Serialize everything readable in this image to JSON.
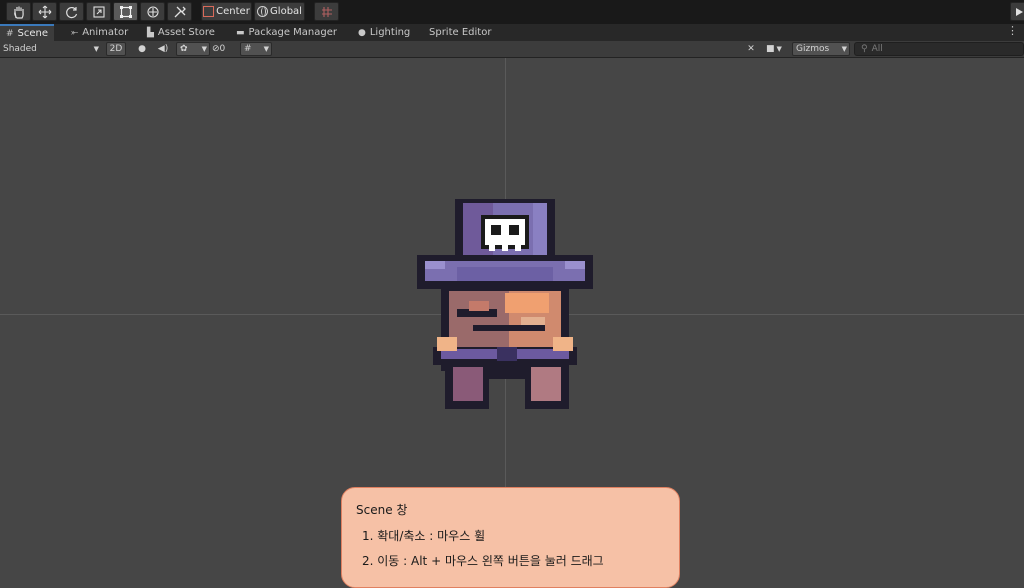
{
  "toolbar": {
    "tools": [
      "hand-tool",
      "move-tool",
      "rotate-tool",
      "scale-tool",
      "rect-tool",
      "transform-tool",
      "custom-tool"
    ],
    "pivot_label": "Center",
    "space_label": "Global"
  },
  "tabs": [
    {
      "label": "Scene",
      "icon": "hash-icon"
    },
    {
      "label": "Animator",
      "icon": "animator-icon"
    },
    {
      "label": "Asset Store",
      "icon": "bag-icon"
    },
    {
      "label": "Package Manager",
      "icon": "package-icon"
    },
    {
      "label": "Lighting",
      "icon": "bulb-icon"
    },
    {
      "label": "Sprite Editor",
      "icon": ""
    }
  ],
  "scenebar": {
    "shading": "Shaded",
    "mode_2d": "2D",
    "hidden_count": "0",
    "gizmos": "Gizmos",
    "search_placeholder": "All"
  },
  "note": {
    "title": "Scene 창",
    "item1": "1. 확대/축소 : 마우스 휠",
    "item2": "2. 이동 : Alt + 마우스 왼쪽 버튼을 눌러 드래그"
  },
  "colors": {
    "accent": "#3a79bb",
    "note_bg": "#f6c1a6",
    "note_border": "#e08060",
    "hat": "#7b6fb0",
    "skin": "#e3a07a"
  }
}
